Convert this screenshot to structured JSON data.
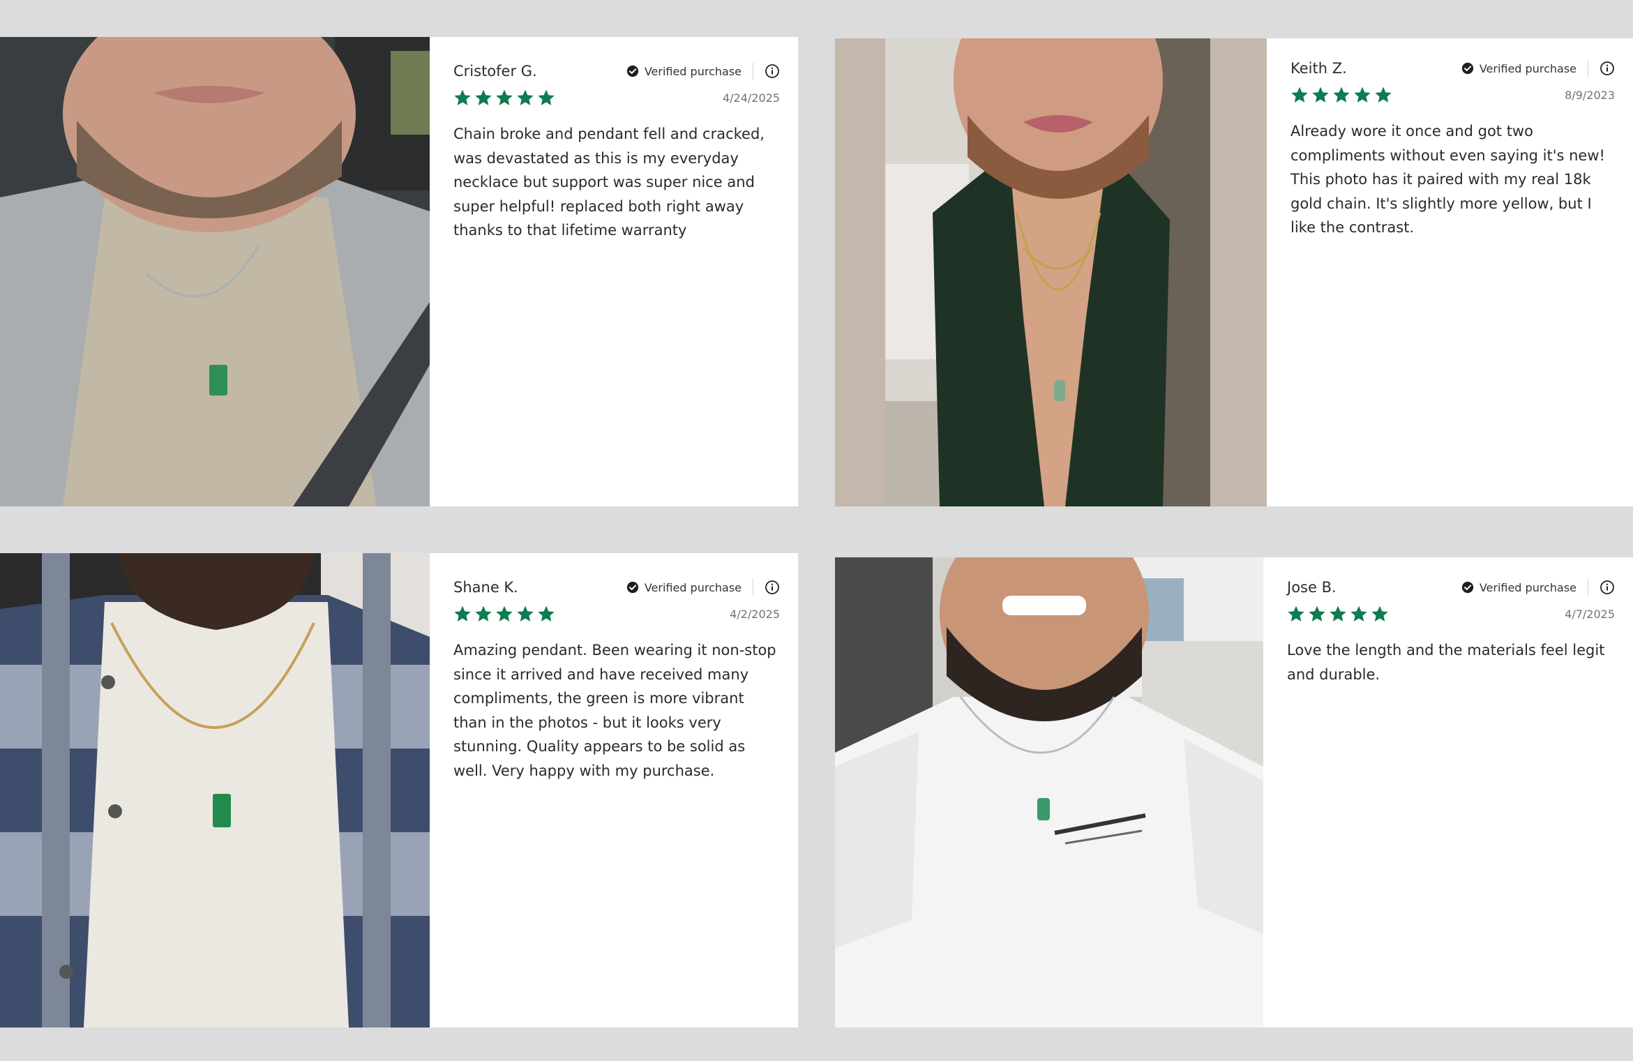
{
  "colors": {
    "page_background": "#dcdcdc",
    "card_background": "#ffffff",
    "star_green": "#0d7c4f",
    "text_dark": "#2b2b2b",
    "text_muted": "#727272"
  },
  "reviews": [
    {
      "name": "Cristofer G.",
      "verified_label": "Verified purchase",
      "rating": 5,
      "date": "4/24/2025",
      "text": "Chain broke and pendant fell and cracked, was devastated as this is my everyday necklace but support was super nice and super helpful! replaced both right away thanks to that lifetime warranty"
    },
    {
      "name": "Keith Z.",
      "verified_label": "Verified purchase",
      "rating": 5,
      "date": "8/9/2023",
      "text": "Already wore it once and got two compliments without even saying it's new! This photo has it paired with my real 18k gold chain. It's slightly more yellow, but I like the contrast."
    },
    {
      "name": "Shane K.",
      "verified_label": "Verified purchase",
      "rating": 5,
      "date": "4/2/2025",
      "text": "Amazing pendant. Been wearing it non-stop since it arrived and have received many compliments, the green is more vibrant than in the photos - but it looks very stunning. Quality appears to be solid as well. Very happy with my purchase."
    },
    {
      "name": "Jose B.",
      "verified_label": "Verified purchase",
      "rating": 5,
      "date": "4/7/2025",
      "text": "Love the length and the materials feel legit and durable."
    }
  ]
}
